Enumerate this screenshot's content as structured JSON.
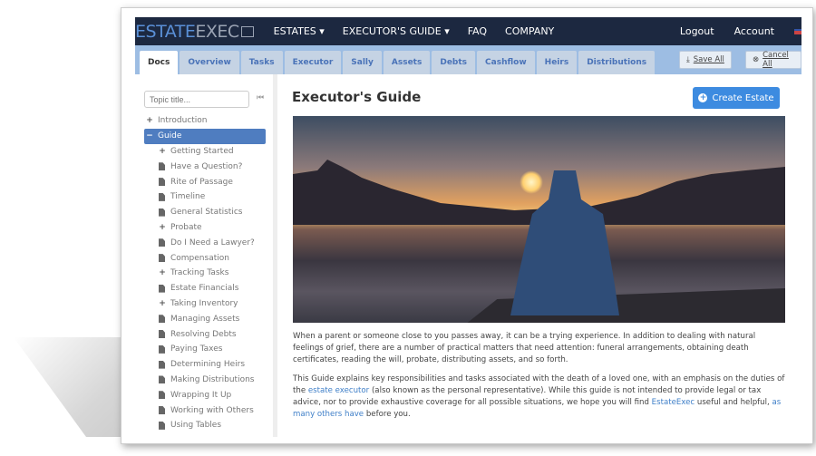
{
  "nav": {
    "logo_a": "ESTATE",
    "logo_b": "EXEC",
    "items": [
      "ESTATES ▾",
      "EXECUTOR'S GUIDE ▾",
      "FAQ",
      "COMPANY"
    ],
    "logout": "Logout",
    "account": "Account"
  },
  "tabs": [
    "Docs",
    "Overview",
    "Tasks",
    "Executor",
    "Sally",
    "Assets",
    "Debts",
    "Cashflow",
    "Heirs",
    "Distributions"
  ],
  "save_all": "Save All",
  "cancel_all": "Cancel All",
  "sidebar": {
    "placeholder": "Topic title...",
    "collapse": "⏮",
    "items": [
      {
        "label": "Introduction",
        "icon": "plus"
      },
      {
        "label": "Guide",
        "icon": "minus",
        "selected": true
      },
      {
        "label": "Getting Started",
        "icon": "plus",
        "sub": true
      },
      {
        "label": "Have a Question?",
        "icon": "doc",
        "sub": true
      },
      {
        "label": "Rite of Passage",
        "icon": "doc",
        "sub": true
      },
      {
        "label": "Timeline",
        "icon": "doc",
        "sub": true
      },
      {
        "label": "General Statistics",
        "icon": "doc",
        "sub": true
      },
      {
        "label": "Probate",
        "icon": "plus",
        "sub": true
      },
      {
        "label": "Do I Need a Lawyer?",
        "icon": "doc",
        "sub": true
      },
      {
        "label": "Compensation",
        "icon": "doc",
        "sub": true
      },
      {
        "label": "Tracking Tasks",
        "icon": "plus",
        "sub": true
      },
      {
        "label": "Estate Financials",
        "icon": "doc",
        "sub": true
      },
      {
        "label": "Taking Inventory",
        "icon": "plus",
        "sub": true
      },
      {
        "label": "Managing Assets",
        "icon": "doc",
        "sub": true
      },
      {
        "label": "Resolving Debts",
        "icon": "doc",
        "sub": true
      },
      {
        "label": "Paying Taxes",
        "icon": "doc",
        "sub": true
      },
      {
        "label": "Determining Heirs",
        "icon": "doc",
        "sub": true
      },
      {
        "label": "Making Distributions",
        "icon": "doc",
        "sub": true
      },
      {
        "label": "Wrapping It Up",
        "icon": "doc",
        "sub": true
      },
      {
        "label": "Working with Others",
        "icon": "doc",
        "sub": true
      },
      {
        "label": "Using Tables",
        "icon": "doc",
        "sub": true
      }
    ]
  },
  "main": {
    "title": "Executor's Guide",
    "create": "Create Estate",
    "p1": "When a parent or someone close to you passes away, it can be a trying experience. In addition to dealing with natural feelings of grief, there are a number of practical matters that need attention: funeral arrangements, obtaining death certificates, reading the will, probate, distributing assets, and so forth.",
    "p2a": "This Guide explains key responsibilities and tasks associated with the death of a loved one, with an emphasis on the duties of the ",
    "p2_link1": "estate executor",
    "p2b": " (also known as the personal representative). While this guide is not intended to provide legal or tax advice, nor to provide exhaustive coverage for all possible situations, we hope you will find ",
    "p2_link2": "EstateExec",
    "p2c": " useful and helpful, ",
    "p2_link3": "as many others have",
    "p2d": " before you."
  },
  "colors": {
    "navbar": "#1c2840",
    "tabbar": "#9dbde3",
    "accent": "#3d8be0",
    "selected": "#4f7dc0"
  }
}
